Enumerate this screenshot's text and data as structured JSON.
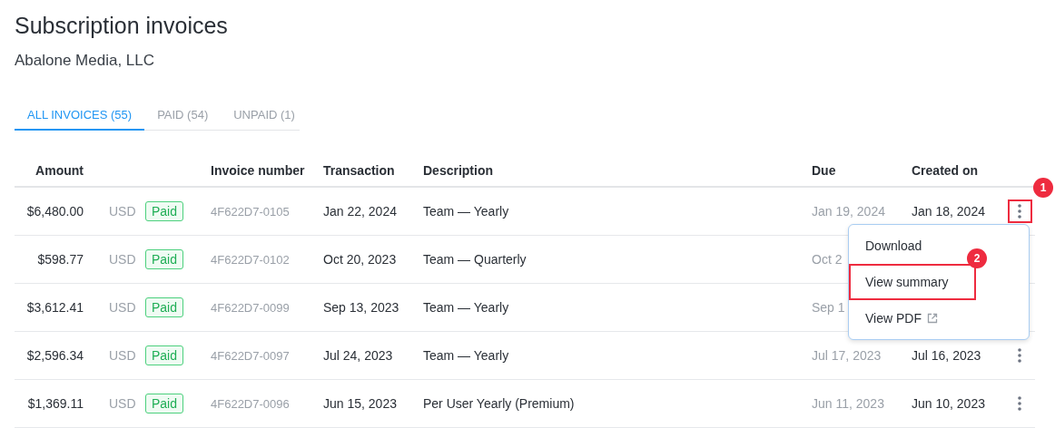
{
  "page": {
    "title": "Subscription invoices",
    "subtitle": "Abalone Media, LLC"
  },
  "tabs": [
    {
      "label": "ALL INVOICES (55)",
      "selected": true
    },
    {
      "label": "PAID (54)",
      "selected": false
    },
    {
      "label": "UNPAID (1)",
      "selected": false
    }
  ],
  "table": {
    "columns": [
      "Amount",
      "",
      "",
      "Invoice number",
      "Transaction",
      "Description",
      "Due",
      "Created on"
    ],
    "rows": [
      {
        "amount": "$6,480.00",
        "currency": "USD",
        "status": "Paid",
        "invoice_number": "4F622D7-0105",
        "transaction": "Jan 22, 2024",
        "description": "Team — Yearly",
        "due": "Jan 19, 2024",
        "created_on": "Jan 18, 2024",
        "more_button": true,
        "annotation": "1"
      },
      {
        "amount": "$598.77",
        "currency": "USD",
        "status": "Paid",
        "invoice_number": "4F622D7-0102",
        "transaction": "Oct 20, 2023",
        "description": "Team — Quarterly",
        "due": "Oct 2",
        "more_button": false
      },
      {
        "amount": "$3,612.41",
        "currency": "USD",
        "status": "Paid",
        "invoice_number": "4F622D7-0099",
        "transaction": "Sep 13, 2023",
        "description": "Team — Yearly",
        "due": "Sep 1",
        "more_button": false
      },
      {
        "amount": "$2,596.34",
        "currency": "USD",
        "status": "Paid",
        "invoice_number": "4F622D7-0097",
        "transaction": "Jul 24, 2023",
        "description": "Team — Yearly",
        "due": "Jul 17, 2023",
        "created_on": "Jul 16, 2023",
        "more_button": true
      },
      {
        "amount": "$1,369.11",
        "currency": "USD",
        "status": "Paid",
        "invoice_number": "4F622D7-0096",
        "transaction": "Jun 15, 2023",
        "description": "Per User Yearly (Premium)",
        "due": "Jun 11, 2023",
        "created_on": "Jun 10, 2023",
        "more_button": true
      }
    ]
  },
  "menu": {
    "items": [
      {
        "label": "Download",
        "kind": "plain"
      },
      {
        "label": "View summary",
        "kind": "plain",
        "annotation": "2"
      },
      {
        "label": "View PDF",
        "kind": "external"
      }
    ]
  }
}
